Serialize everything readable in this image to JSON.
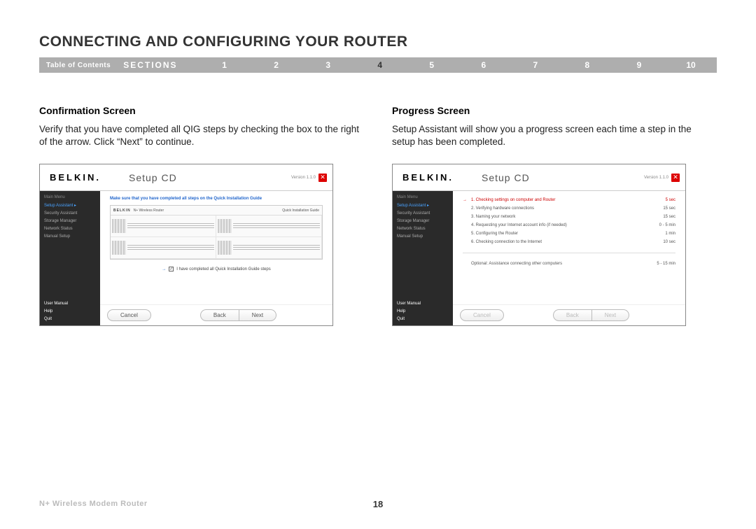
{
  "page_title": "CONNECTING AND CONFIGURING YOUR ROUTER",
  "nav": {
    "toc": "Table of Contents",
    "sections_label": "SECTIONS",
    "numbers": [
      "1",
      "2",
      "3",
      "4",
      "5",
      "6",
      "7",
      "8",
      "9",
      "10"
    ],
    "current": "4"
  },
  "left": {
    "heading": "Confirmation Screen",
    "body": "Verify that you have completed all QIG steps by checking the box to the right of the arrow. Click “Next” to continue.",
    "shot": {
      "logo": "BELKIN.",
      "title": "Setup CD",
      "version": "Version 1.1.0",
      "sidebar": {
        "header": "Main Menu",
        "active": "Setup Assistant  ▸",
        "items": [
          "Security Assistant",
          "Storage Manager",
          "Network Status",
          "Manual Setup"
        ],
        "bottom": [
          "User Manual",
          "Help",
          "Quit"
        ]
      },
      "instruction": "Make sure that you have completed all steps on the Quick Installation Guide",
      "qig_header_logo": "BELKIN",
      "qig_header_a": "N+ Wireless Router",
      "qig_header_b": "Quick Installation Guide",
      "confirm_text": "I have completed all Quick Installation Guide steps",
      "check_mark": "✓",
      "arrow": "→",
      "buttons": {
        "cancel": "Cancel",
        "back": "Back",
        "next": "Next"
      }
    }
  },
  "right": {
    "heading": "Progress Screen",
    "body": "Setup Assistant will show you a progress screen each time a step in the setup has been completed.",
    "shot": {
      "logo": "BELKIN.",
      "title": "Setup CD",
      "version": "Version 1.1.0",
      "sidebar": {
        "header": "Main Menu",
        "active": "Setup Assistant  ▸",
        "items": [
          "Security Assistant",
          "Storage Manager",
          "Network Status",
          "Manual Setup"
        ],
        "bottom": [
          "User Manual",
          "Help",
          "Quit"
        ]
      },
      "arrow": "→",
      "steps": [
        {
          "label": "1. Checking settings on computer and Router",
          "time": "5 sec"
        },
        {
          "label": "2. Verifying hardware connections",
          "time": "15 sec"
        },
        {
          "label": "3. Naming your network",
          "time": "15 sec"
        },
        {
          "label": "4. Requesting your Internet account info (if needed)",
          "time": "0 - 5 min"
        },
        {
          "label": "5. Configuring the Router",
          "time": "1 min"
        },
        {
          "label": "6. Checking connection to the Internet",
          "time": "10 sec"
        }
      ],
      "optional": {
        "label": "Optional: Assistance connecting other computers",
        "time": "5 - 15 min"
      },
      "buttons": {
        "cancel": "Cancel",
        "back": "Back",
        "next": "Next"
      }
    }
  },
  "footer": {
    "product": "N+ Wireless Modem Router",
    "page": "18"
  }
}
